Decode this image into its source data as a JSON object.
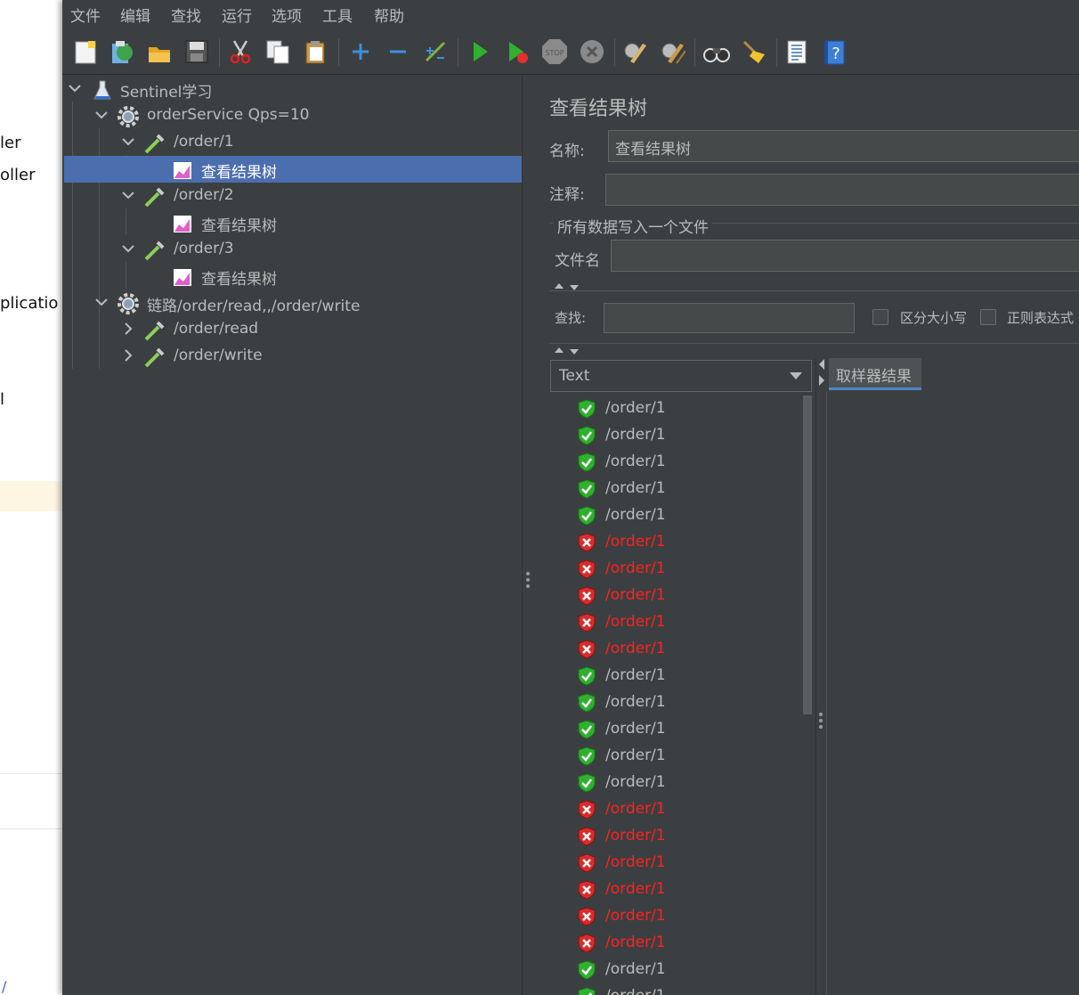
{
  "background_window": {
    "fragments": [
      "ler",
      "oller",
      "plicatio",
      "l",
      "/"
    ]
  },
  "menu": [
    "文件",
    "编辑",
    "查找",
    "运行",
    "选项",
    "工具",
    "帮助"
  ],
  "toolbar": {
    "buttons": [
      "new-icon",
      "templates-icon",
      "open-icon",
      "save-icon",
      "cut-icon",
      "copy-icon",
      "paste-icon",
      "expand-icon",
      "collapse-icon",
      "toggle-icon",
      "start-icon",
      "start-no-pause-icon",
      "stop-icon",
      "shutdown-icon",
      "clear-icon",
      "clear-all-icon",
      "search-icon",
      "reset-search-icon",
      "function-helper-icon",
      "help-icon"
    ],
    "stop_label": "STOP"
  },
  "tree": {
    "items": [
      {
        "label": "Sentinel学习",
        "type": "test-plan"
      },
      {
        "label": "orderService Qps=10",
        "type": "thread-group"
      },
      {
        "label": "/order/1",
        "type": "sampler"
      },
      {
        "label": "查看结果树",
        "type": "listener",
        "selected": true
      },
      {
        "label": "/order/2",
        "type": "sampler"
      },
      {
        "label": "查看结果树",
        "type": "listener"
      },
      {
        "label": "/order/3",
        "type": "sampler"
      },
      {
        "label": "查看结果树",
        "type": "listener"
      },
      {
        "label": "链路/order/read,,/order/write",
        "type": "thread-group"
      },
      {
        "label": "/order/read",
        "type": "sampler"
      },
      {
        "label": "/order/write",
        "type": "sampler"
      }
    ]
  },
  "panel": {
    "title": "查看结果树",
    "name_label": "名称:",
    "name_value": "查看结果树",
    "comment_label": "注释:",
    "comment_value": "",
    "file_section_label": "所有数据写入一个文件",
    "filename_label": "文件名",
    "filename_value": "",
    "search_label": "查找:",
    "search_value": "",
    "case_sensitive_label": "区分大小写",
    "regex_label": "正则表达式",
    "renderer_value": "Text",
    "tab_sampler_result": "取样器结果"
  },
  "colors": {
    "success": "#2fb12f",
    "error": "#ff2020",
    "selection": "#4b6eaf"
  },
  "results": [
    {
      "label": "/order/1",
      "status": "success"
    },
    {
      "label": "/order/1",
      "status": "success"
    },
    {
      "label": "/order/1",
      "status": "success"
    },
    {
      "label": "/order/1",
      "status": "success"
    },
    {
      "label": "/order/1",
      "status": "success"
    },
    {
      "label": "/order/1",
      "status": "error"
    },
    {
      "label": "/order/1",
      "status": "error"
    },
    {
      "label": "/order/1",
      "status": "error"
    },
    {
      "label": "/order/1",
      "status": "error"
    },
    {
      "label": "/order/1",
      "status": "error"
    },
    {
      "label": "/order/1",
      "status": "success"
    },
    {
      "label": "/order/1",
      "status": "success"
    },
    {
      "label": "/order/1",
      "status": "success"
    },
    {
      "label": "/order/1",
      "status": "success"
    },
    {
      "label": "/order/1",
      "status": "success"
    },
    {
      "label": "/order/1",
      "status": "error"
    },
    {
      "label": "/order/1",
      "status": "error"
    },
    {
      "label": "/order/1",
      "status": "error"
    },
    {
      "label": "/order/1",
      "status": "error"
    },
    {
      "label": "/order/1",
      "status": "error"
    },
    {
      "label": "/order/1",
      "status": "error"
    },
    {
      "label": "/order/1",
      "status": "success"
    },
    {
      "label": "/order/1",
      "status": "success"
    }
  ]
}
